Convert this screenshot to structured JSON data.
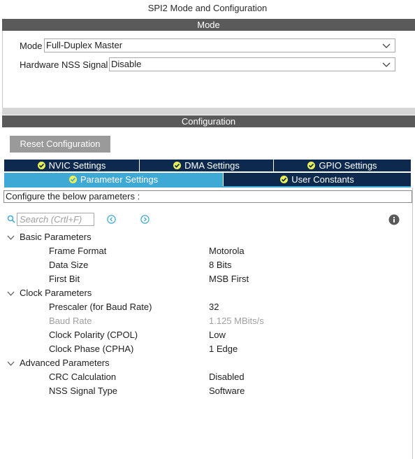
{
  "title": "SPI2 Mode and Configuration",
  "mode_section": {
    "header": "Mode",
    "mode_label": "Mode",
    "mode_value": "Full-Duplex Master",
    "nss_label": "Hardware NSS Signal",
    "nss_value": "Disable"
  },
  "config_section": {
    "header": "Configuration",
    "reset_button": "Reset Configuration",
    "tabs_row1": [
      "NVIC Settings",
      "DMA Settings",
      "GPIO Settings"
    ],
    "tabs_row2": [
      "Parameter Settings",
      "User Constants"
    ],
    "active_tab": "Parameter Settings",
    "instruction": "Configure the below parameters :",
    "search_placeholder": "Search (Crtl+F)"
  },
  "groups": [
    {
      "name": "Basic Parameters",
      "params": [
        {
          "name": "Frame Format",
          "value": "Motorola",
          "disabled": false
        },
        {
          "name": "Data Size",
          "value": "8 Bits",
          "disabled": false
        },
        {
          "name": "First Bit",
          "value": "MSB First",
          "disabled": false
        }
      ]
    },
    {
      "name": "Clock Parameters",
      "params": [
        {
          "name": "Prescaler (for Baud Rate)",
          "value": "32",
          "disabled": false
        },
        {
          "name": "Baud Rate",
          "value": "1.125 MBits/s",
          "disabled": true
        },
        {
          "name": "Clock Polarity (CPOL)",
          "value": "Low",
          "disabled": false
        },
        {
          "name": "Clock Phase (CPHA)",
          "value": "1 Edge",
          "disabled": false
        }
      ]
    },
    {
      "name": "Advanced Parameters",
      "params": [
        {
          "name": "CRC Calculation",
          "value": "Disabled",
          "disabled": false
        },
        {
          "name": "NSS Signal Type",
          "value": "Software",
          "disabled": false
        }
      ]
    }
  ],
  "colors": {
    "header_bar": "#5a5a5a",
    "tab_dark": "#0d2a4e",
    "tab_active": "#3fa9d6",
    "tick": "#e9f05a",
    "nav_icon": "#3fa9d6"
  }
}
